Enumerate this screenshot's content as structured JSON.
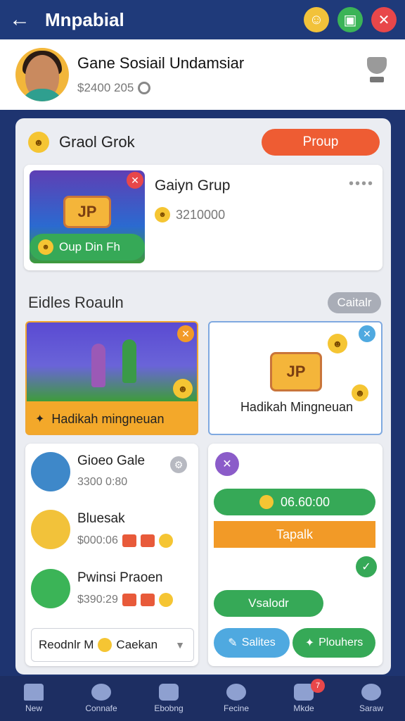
{
  "topbar": {
    "title": "Mnpabial",
    "back_icon": "arrow-left-icon",
    "actions": [
      "avatar-icon",
      "shop-icon",
      "close-icon"
    ]
  },
  "profile": {
    "name": "Gane Sosiail Undamsiar",
    "balance": "$2400 205"
  },
  "group": {
    "title": "Graol Grok",
    "button_label": "Proup",
    "card": {
      "name": "Gaiyn Grup",
      "count": "3210000",
      "join_label": "Oup Din Fh",
      "badge_text": "JP"
    }
  },
  "section": {
    "title": "Eidles Roauln",
    "button_label": "Caitalr"
  },
  "gifts": [
    {
      "label": "Hadikah mingneuan"
    },
    {
      "label": "Hadikah Mingneuan",
      "badge_text": "JP"
    }
  ],
  "leaderboard": {
    "rows": [
      {
        "name": "Gioeo Gale",
        "value": "3300 0:80"
      },
      {
        "name": "Bluesak",
        "value": "$000:06"
      },
      {
        "name": "Pwinsi Praoen",
        "value": "$390:29"
      }
    ],
    "select_label": "Reodnlr M",
    "select_value": "Caekan"
  },
  "actions": {
    "amount": "06.60:00",
    "orange_label": "Tapalk",
    "green_label": "Vsalodr",
    "blue_label": "Salites",
    "green2_label": "Plouhers"
  },
  "nav": {
    "items": [
      {
        "label": "New"
      },
      {
        "label": "Connafe"
      },
      {
        "label": "Ebobng"
      },
      {
        "label": "Fecine"
      },
      {
        "label": "Mkde",
        "badge": "7"
      },
      {
        "label": "Saraw"
      }
    ]
  }
}
